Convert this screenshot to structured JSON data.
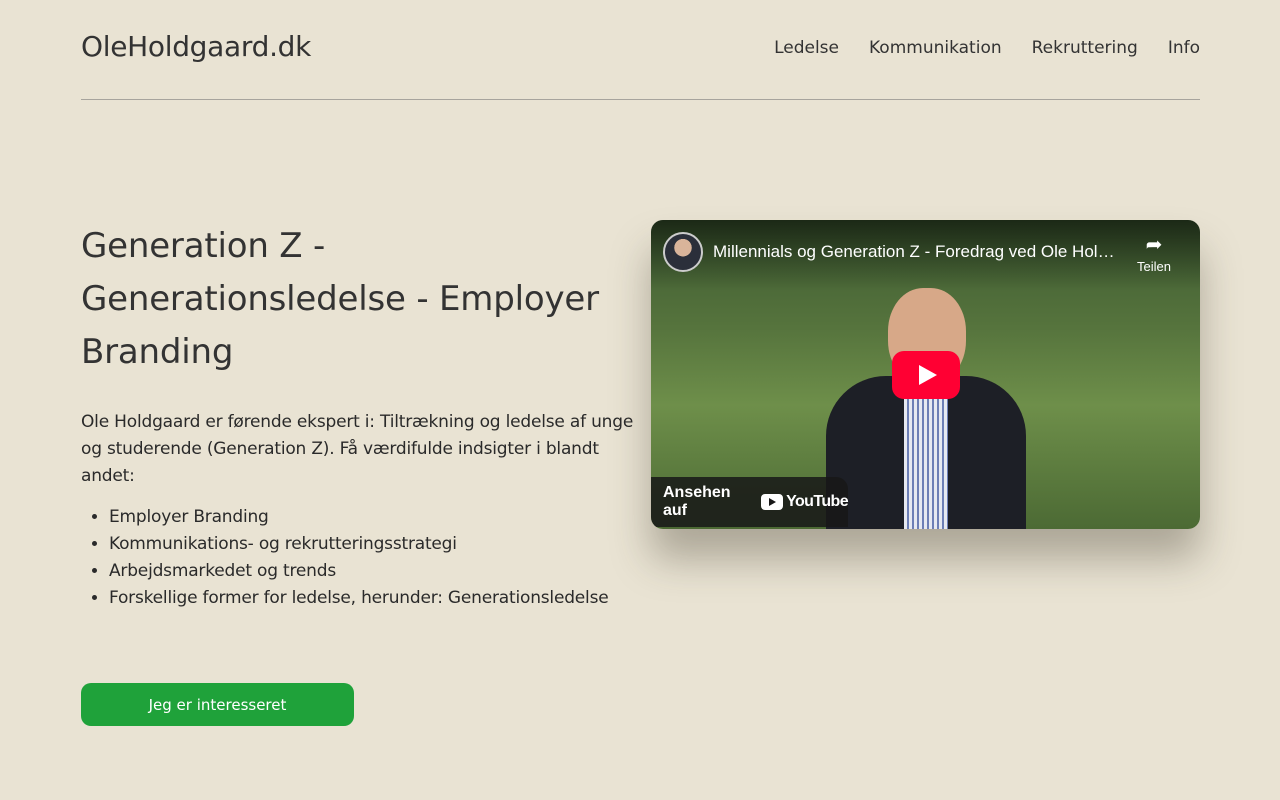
{
  "header": {
    "logo": "OleHoldgaard.dk",
    "nav": [
      "Ledelse",
      "Kommunikation",
      "Rekruttering",
      "Info"
    ]
  },
  "main": {
    "title": "Generation Z - Generationsledelse - Employer Branding",
    "intro": "Ole Holdgaard er førende ekspert i: Tiltrækning og ledelse af unge og studerende (Generation Z). Få værdifulde indsigter i blandt andet:",
    "bullets": [
      "Employer Branding",
      "Kommunikations- og rekrutteringsstrategi",
      "Arbejdsmarkedet og trends",
      "Forskellige former for ledelse, herunder: Generationsledelse"
    ],
    "cta_label": "Jeg er interesseret"
  },
  "video": {
    "title": "Millennials og Generation Z - Foredrag ved Ole Holdgaard",
    "share_label": "Teilen",
    "watch_label": "Ansehen auf",
    "youtube_text": "YouTube"
  },
  "colors": {
    "background": "#e9e3d3",
    "cta": "#1fa23a",
    "play_button": "#ff0033"
  }
}
